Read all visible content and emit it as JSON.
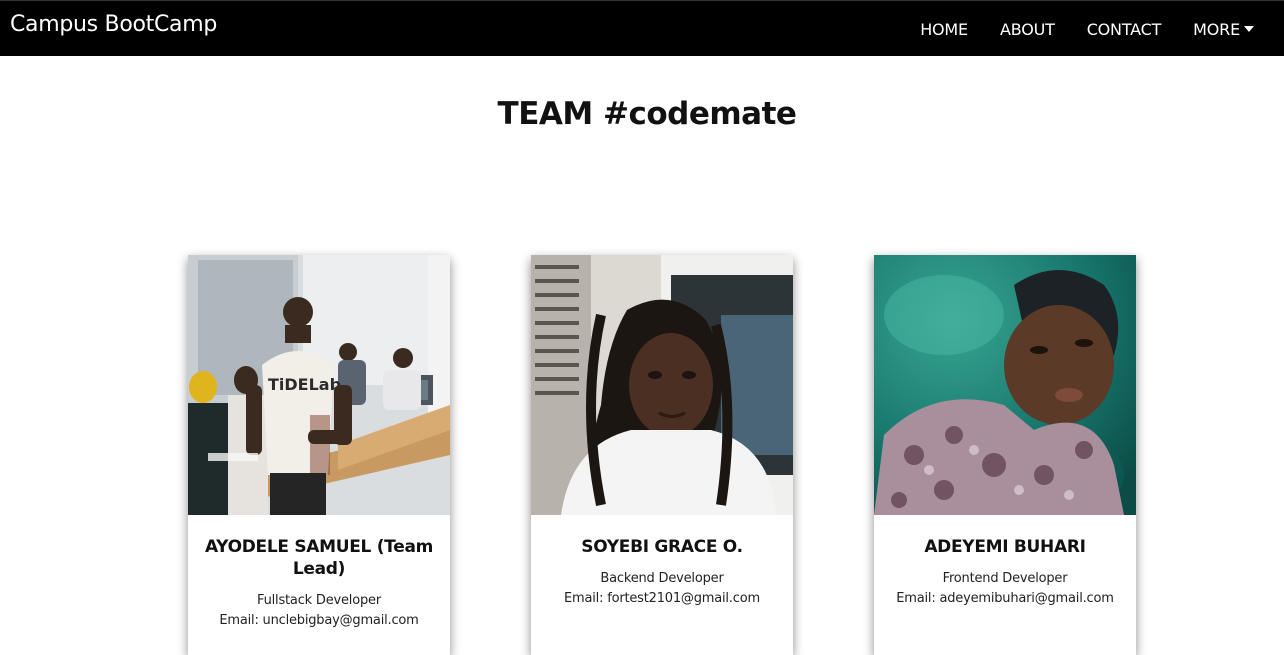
{
  "navbar": {
    "brand": "Campus BootCamp",
    "links": [
      "HOME",
      "ABOUT",
      "CONTACT",
      "MORE"
    ],
    "more_icon": "caret-down-icon"
  },
  "page": {
    "title": "TEAM #codemate"
  },
  "team": [
    {
      "name": "AYODELE SAMUEL (Team Lead)",
      "role": "Fullstack Developer",
      "email": "Email: unclebigbay@gmail.com",
      "photo_alt": "photo of man standing in classroom"
    },
    {
      "name": "SOYEBI GRACE O.",
      "role": "Backend Developer",
      "email": "Email: fortest2101@gmail.com",
      "photo_alt": "selfie of woman with braids"
    },
    {
      "name": "ADEYEMI BUHARI",
      "role": "Frontend Developer",
      "email": "Email: adeyemibuhari@gmail.com",
      "photo_alt": "photo of man in beanie"
    }
  ]
}
